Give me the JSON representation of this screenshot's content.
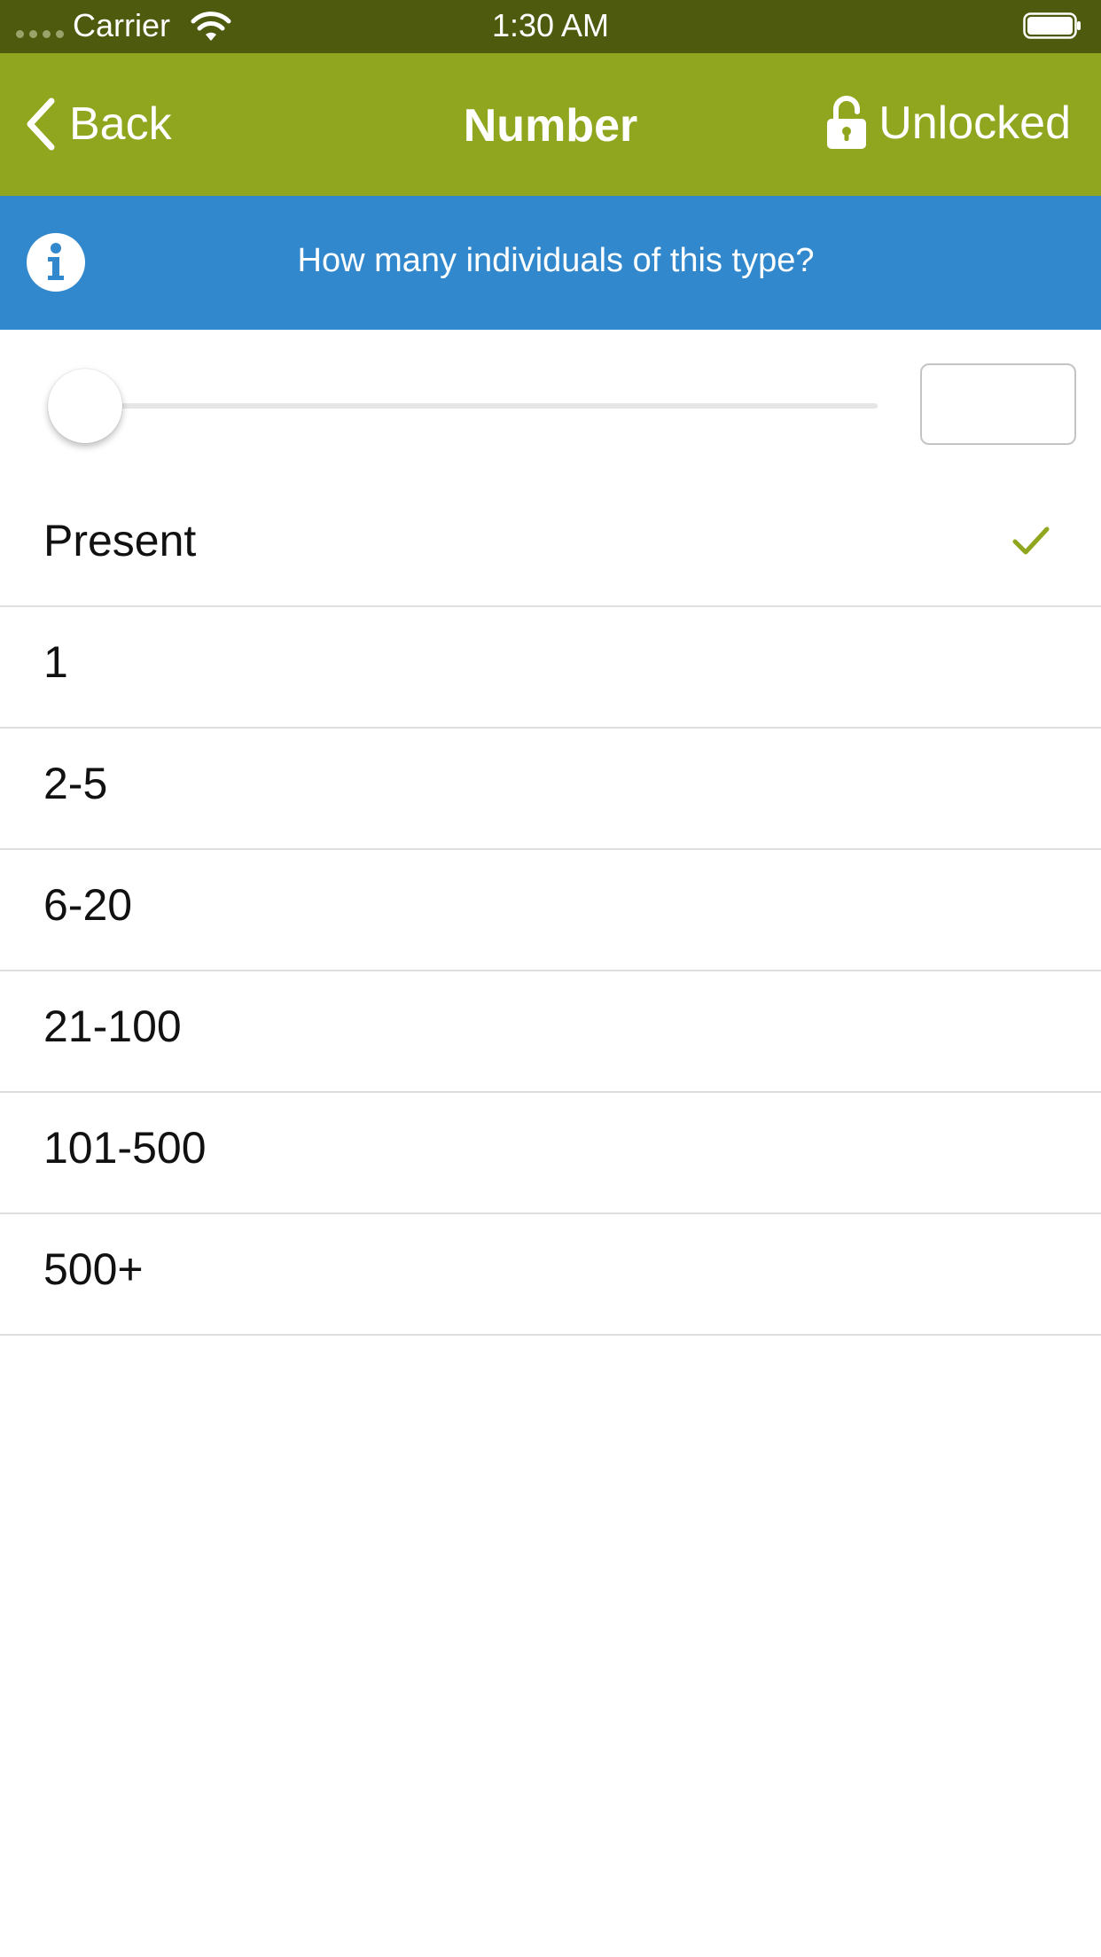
{
  "status_bar": {
    "carrier": "Carrier",
    "time": "1:30 AM",
    "icons": [
      "signal-dots-icon",
      "wifi-icon",
      "battery-icon"
    ]
  },
  "nav": {
    "back_label": "Back",
    "title": "Number",
    "lock_label": "Unlocked",
    "back_icon": "chevron-left-icon",
    "lock_icon": "unlocked-padlock-icon"
  },
  "info": {
    "icon": "info-icon",
    "text": "How many individuals of this type?"
  },
  "slider": {
    "value": 0,
    "input_value": ""
  },
  "options": {
    "selected_index": 0,
    "items": [
      {
        "label": "Present"
      },
      {
        "label": "1"
      },
      {
        "label": "2-5"
      },
      {
        "label": "6-20"
      },
      {
        "label": "21-100"
      },
      {
        "label": "101-500"
      },
      {
        "label": "500+"
      }
    ]
  },
  "colors": {
    "status_bar": "#4e5a0e",
    "nav_bar": "#8fa61e",
    "info_banner": "#3288cc",
    "checkmark": "#8fa61e"
  }
}
